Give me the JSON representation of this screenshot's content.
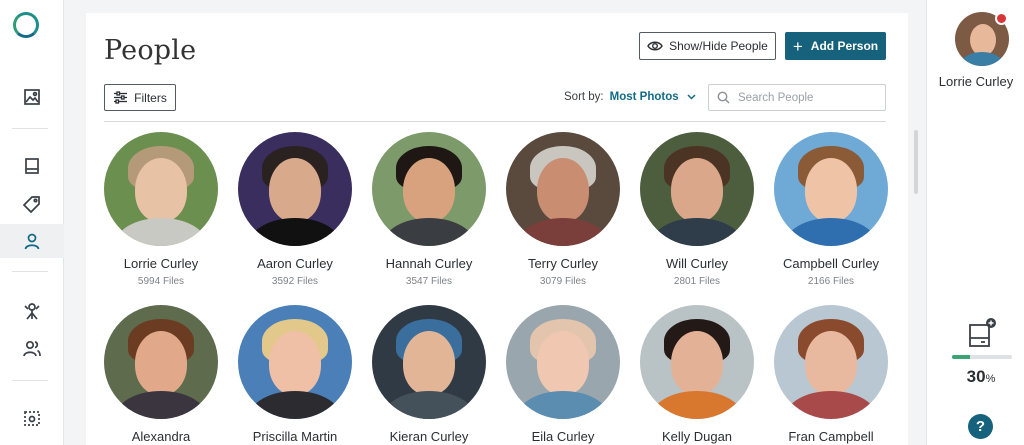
{
  "header": {
    "title": "People",
    "show_hide_label": "Show/Hide People",
    "add_person_label": "Add Person",
    "add_person_plus": "+"
  },
  "toolbar": {
    "filters_label": "Filters",
    "sort_label": "Sort by:",
    "sort_value": "Most Photos",
    "search_placeholder": "Search People"
  },
  "people": [
    {
      "name": "Lorrie Curley",
      "files": "5994 Files"
    },
    {
      "name": "Aaron Curley",
      "files": "3592 Files"
    },
    {
      "name": "Hannah Curley",
      "files": "3547 Files"
    },
    {
      "name": "Terry Curley",
      "files": "3079 Files"
    },
    {
      "name": "Will Curley",
      "files": "2801 Files"
    },
    {
      "name": "Campbell Curley",
      "files": "2166 Files"
    },
    {
      "name": "Alexandra",
      "files": ""
    },
    {
      "name": "Priscilla Martin",
      "files": ""
    },
    {
      "name": "Kieran Curley",
      "files": ""
    },
    {
      "name": "Eila Curley",
      "files": ""
    },
    {
      "name": "Kelly Dugan",
      "files": ""
    },
    {
      "name": "Fran Campbell",
      "files": ""
    }
  ],
  "account": {
    "name": "Lorrie Curley",
    "storage_percent": "30",
    "storage_unit": "%",
    "storage_fraction": 0.3,
    "help_label": "?"
  },
  "nav_icons": [
    "photos-icon",
    "albums-icon",
    "tags-icon",
    "people-icon",
    "memories-icon",
    "groups-icon",
    "add-media-icon"
  ],
  "colors": {
    "primary": "#16617c",
    "accent": "#136a86",
    "storage_fill": "#3aa472",
    "notification": "#d83636"
  }
}
